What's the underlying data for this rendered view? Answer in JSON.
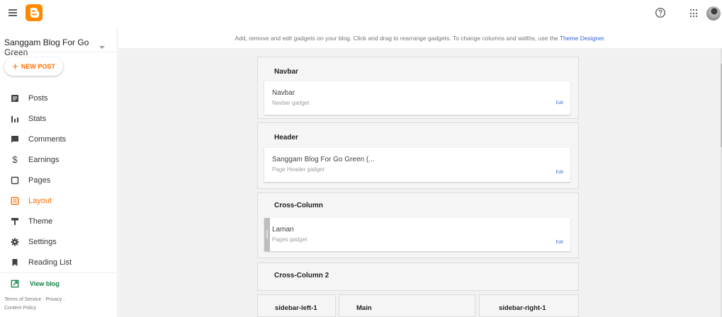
{
  "topbar": {
    "menu_icon": "menu-icon",
    "logo_icon": "blogger-logo",
    "help_icon": "help-icon",
    "apps_icon": "apps-icon",
    "accent": "#ff8a00"
  },
  "sidebar": {
    "blog_name": "Sanggam Blog For Go Green",
    "new_post_label": "NEW POST",
    "items": [
      {
        "label": "Posts",
        "icon": "posts-icon",
        "active": false
      },
      {
        "label": "Stats",
        "icon": "stats-icon",
        "active": false
      },
      {
        "label": "Comments",
        "icon": "comments-icon",
        "active": false
      },
      {
        "label": "Earnings",
        "icon": "earnings-icon",
        "active": false
      },
      {
        "label": "Pages",
        "icon": "pages-icon",
        "active": false
      },
      {
        "label": "Layout",
        "icon": "layout-icon",
        "active": true
      },
      {
        "label": "Theme",
        "icon": "theme-icon",
        "active": false
      },
      {
        "label": "Settings",
        "icon": "settings-icon",
        "active": false
      },
      {
        "label": "Reading List",
        "icon": "reading-list-icon",
        "active": false
      }
    ],
    "view_blog": "View blog",
    "footer": {
      "terms": "Terms of Service",
      "privacy": "Privacy",
      "content_policy": "Content Policy"
    },
    "active_color": "#ff6d00"
  },
  "info": {
    "text": "Add, remove and edit gadgets on your blog. Click and drag to rearrange gadgets. To change columns and widths, use the ",
    "link": "Theme Designer",
    "suffix": "."
  },
  "layout": {
    "sections": [
      {
        "title": "Navbar",
        "gadget": {
          "title": "Navbar",
          "subtitle": "Navbar gadget",
          "edit": "Edit"
        }
      },
      {
        "title": "Header",
        "gadget": {
          "title": "Sanggam Blog For Go Green (...",
          "subtitle": "Page Header gadget",
          "edit": "Edit"
        }
      },
      {
        "title": "Cross-Column",
        "gadget": {
          "title": "Laman",
          "subtitle": "Pages gadget",
          "edit": "Edit"
        }
      },
      {
        "title": "Cross-Column 2"
      }
    ],
    "columns": [
      "sidebar-left-1",
      "Main",
      "sidebar-right-1"
    ]
  }
}
